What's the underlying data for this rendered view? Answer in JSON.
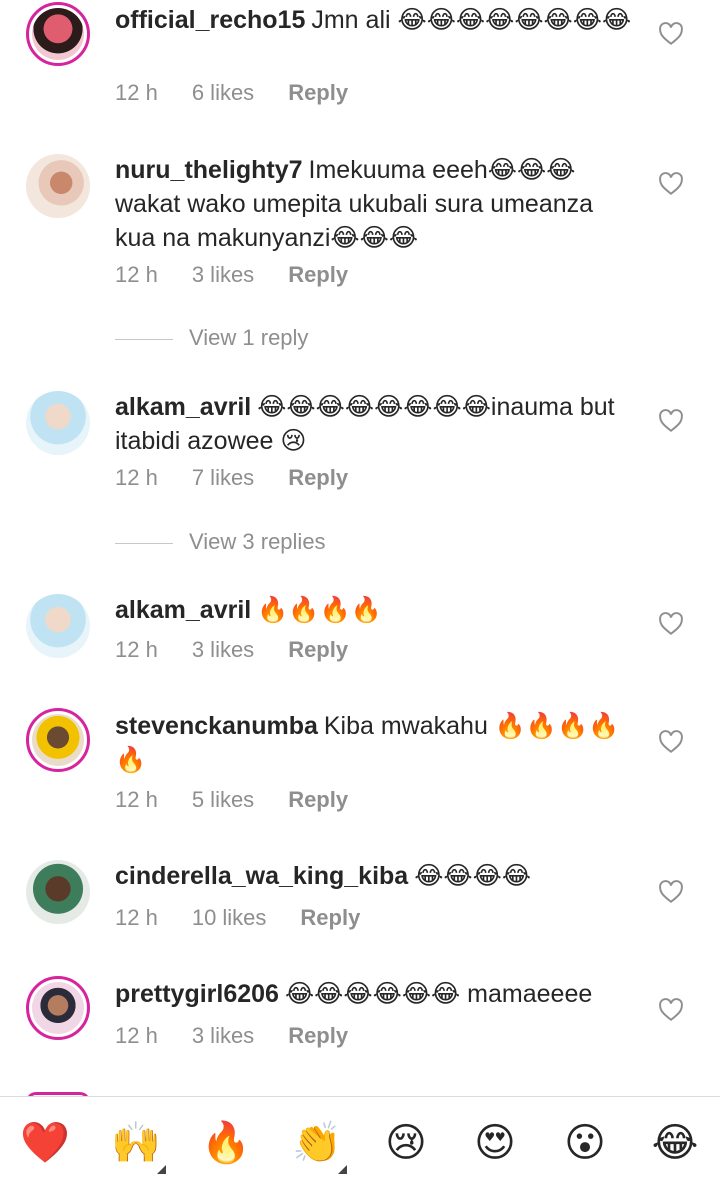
{
  "comments": [
    {
      "user": "official_recho15",
      "text": "Jmn ali 😂😂😂😂😂😂😂😂",
      "time": "12 h",
      "likes": "6 likes",
      "reply": "Reply",
      "view": ""
    },
    {
      "user": "nuru_thelighty7",
      "text": "Imekuuma eeeh😂😂😂 wakat wako umepita ukubali sura umeanza kua na makunyanzi😂😂😂",
      "time": "12 h",
      "likes": "3 likes",
      "reply": "Reply",
      "view": "View 1 reply"
    },
    {
      "user": "alkam_avril",
      "text": "😂😂😂😂😂😂😂😂inauma but itabidi azowee 😢",
      "time": "12 h",
      "likes": "7 likes",
      "reply": "Reply",
      "view": "View 3 replies"
    },
    {
      "user": "alkam_avril",
      "text": "🔥🔥🔥🔥",
      "time": "12 h",
      "likes": "3 likes",
      "reply": "Reply",
      "view": ""
    },
    {
      "user": "stevenckanumba",
      "text": "Kiba mwakahu 🔥🔥🔥🔥🔥",
      "time": "12 h",
      "likes": "5 likes",
      "reply": "Reply",
      "view": ""
    },
    {
      "user": "cinderella_wa_king_kiba",
      "text": "😂😂😂😂",
      "time": "12 h",
      "likes": "10 likes",
      "reply": "Reply",
      "view": ""
    },
    {
      "user": "prettygirl6206",
      "text": "😂😂😂😂😂😂 mamaeeee",
      "time": "12 h",
      "likes": "3 likes",
      "reply": "Reply",
      "view": ""
    }
  ],
  "reactions": [
    "❤️",
    "🙌",
    "🔥",
    "👏",
    "😢",
    "😍",
    "😮",
    "😂"
  ],
  "colors": {
    "text": "#262626",
    "meta": "#8e8e8e",
    "story_ring": "#d6249f",
    "heart": "#ed4956"
  }
}
